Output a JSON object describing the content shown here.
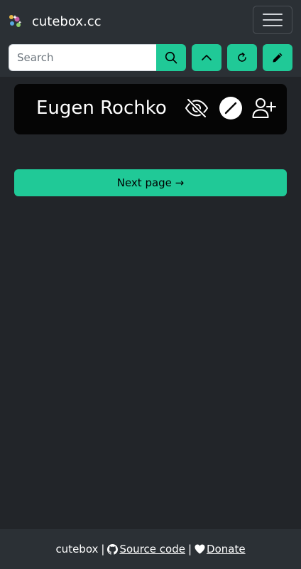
{
  "navbar": {
    "brand_name": "cutebox.cc",
    "brand_icon": "cutebox-logo-icon",
    "menu_icon": "hamburger-menu-icon"
  },
  "search": {
    "placeholder": "Search",
    "value": "",
    "button_icon": "search-icon"
  },
  "toolbar": {
    "scroll_top_icon": "chevron-up-icon",
    "refresh_icon": "refresh-icon",
    "compose_icon": "pencil-icon"
  },
  "profile_card": {
    "name": "Eugen Rochko",
    "icons": [
      "eye-slash-icon",
      "block-icon",
      "person-add-icon"
    ]
  },
  "pagination": {
    "next_label": "Next page →"
  },
  "footer": {
    "brand": "cutebox",
    "source_label": "Source code",
    "donate_label": "Donate",
    "separator": "|"
  },
  "colors": {
    "accent": "#20c997",
    "page_bg": "#222529",
    "navbar_bg": "#2b3035",
    "card_bg": "#050505"
  }
}
